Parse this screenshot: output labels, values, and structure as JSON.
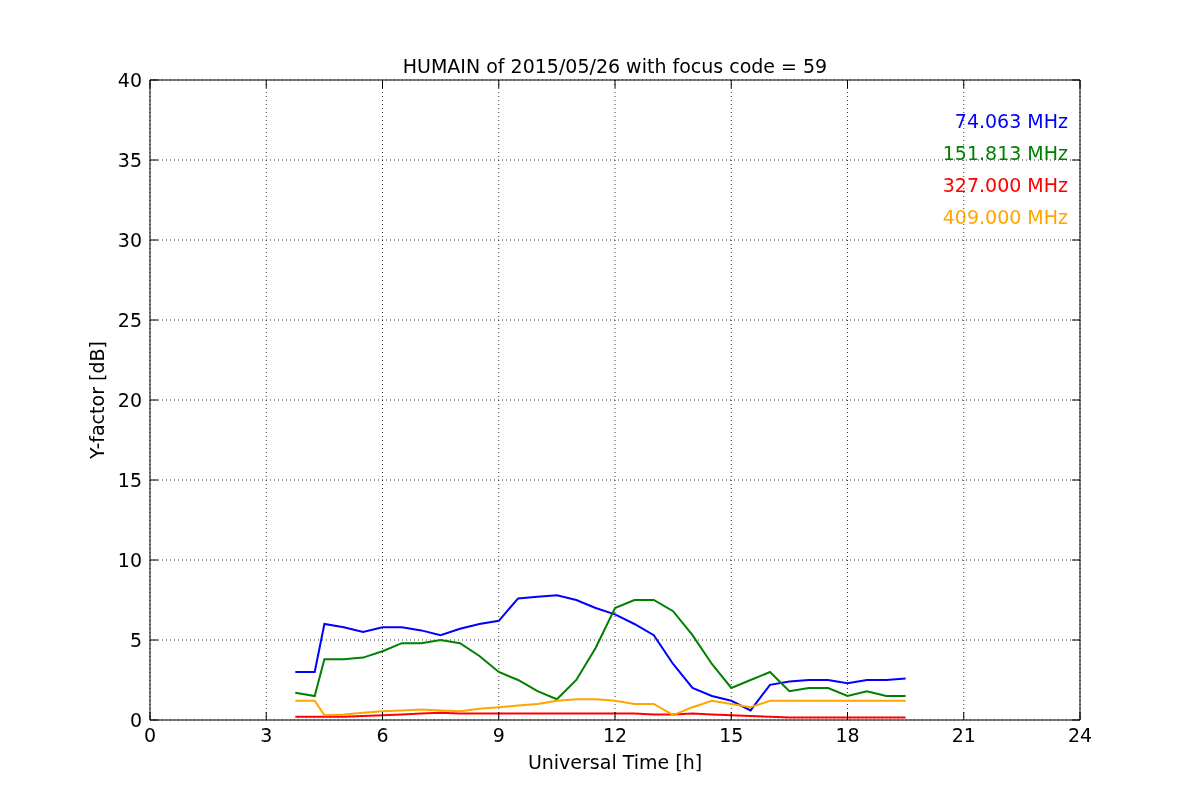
{
  "chart": {
    "chart_data": {
      "type": "line",
      "title": "HUMAIN of 2015/05/26 with focus code = 59",
      "xlabel": "Universal Time [h]",
      "ylabel": "Y-factor [dB]",
      "x": [
        3.75,
        4.25,
        4.5,
        5,
        5.5,
        6,
        6.5,
        7,
        7.5,
        8,
        8.5,
        9,
        9.5,
        10,
        10.5,
        11,
        11.5,
        12,
        12.5,
        13,
        13.5,
        14,
        14.5,
        15,
        15.5,
        16,
        16.5,
        17,
        17.5,
        18,
        18.5,
        19,
        19.5
      ],
      "series": [
        {
          "name": "74.063 MHz",
          "color": "#0000ff",
          "values": [
            3,
            3,
            6,
            5.8,
            5.5,
            5.8,
            5.8,
            5.6,
            5.3,
            5.7,
            6,
            6.2,
            7.6,
            7.7,
            7.8,
            7.5,
            7,
            6.6,
            6,
            5.3,
            3.5,
            2,
            1.5,
            1.2,
            0.6,
            2.2,
            2.4,
            2.5,
            2.5,
            2.3,
            2.5,
            2.5,
            2.6
          ]
        },
        {
          "name": "151.813 MHz",
          "color": "#008000",
          "values": [
            1.7,
            1.5,
            3.8,
            3.8,
            3.9,
            4.3,
            4.8,
            4.8,
            5,
            4.8,
            4,
            3,
            2.5,
            1.8,
            1.3,
            2.5,
            4.5,
            7,
            7.5,
            7.5,
            6.8,
            5.3,
            3.5,
            2,
            2.5,
            3,
            1.8,
            2,
            2,
            1.5,
            1.8,
            1.5,
            1.5
          ]
        },
        {
          "name": "327.000 MHz",
          "color": "#ff0000",
          "values": [
            0.2,
            0.2,
            0.2,
            0.2,
            0.25,
            0.3,
            0.35,
            0.4,
            0.45,
            0.4,
            0.4,
            0.4,
            0.4,
            0.4,
            0.4,
            0.4,
            0.4,
            0.4,
            0.4,
            0.35,
            0.35,
            0.4,
            0.35,
            0.3,
            0.25,
            0.2,
            0.15,
            0.15,
            0.15,
            0.15,
            0.15,
            0.15,
            0.15
          ]
        },
        {
          "name": "409.000 MHz",
          "color": "#ffa500",
          "values": [
            1.2,
            1.2,
            0.3,
            0.35,
            0.45,
            0.55,
            0.6,
            0.65,
            0.6,
            0.55,
            0.7,
            0.8,
            0.9,
            1,
            1.2,
            1.3,
            1.3,
            1.2,
            1,
            1,
            0.3,
            0.8,
            1.2,
            1,
            0.8,
            1.2,
            1.2,
            1.2,
            1.2,
            1.2,
            1.2,
            1.2,
            1.2
          ]
        }
      ],
      "xlim": [
        0,
        24
      ],
      "ylim": [
        0,
        40
      ],
      "xticks": [
        0,
        3,
        6,
        9,
        12,
        15,
        18,
        21,
        24
      ],
      "yticks": [
        0,
        5,
        10,
        15,
        20,
        25,
        30,
        35,
        40
      ],
      "grid": true
    }
  }
}
